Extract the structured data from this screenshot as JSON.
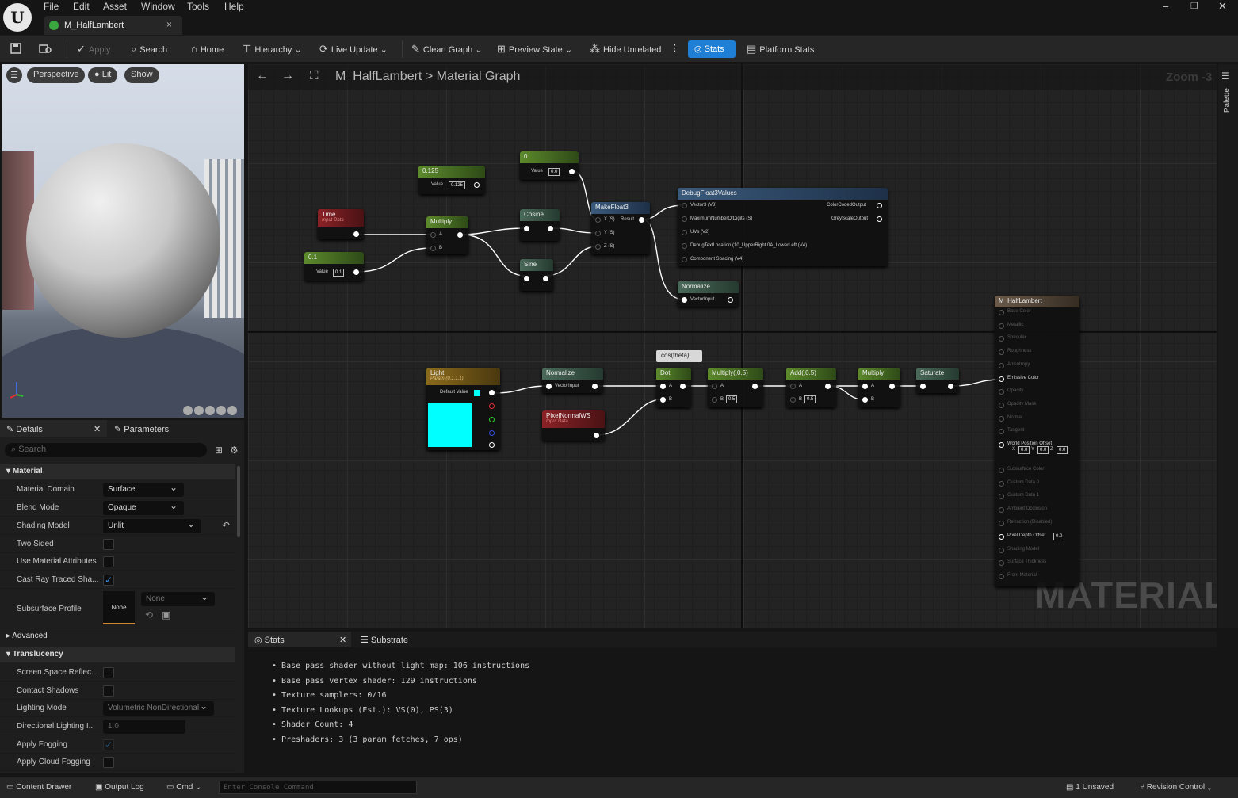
{
  "menubar": {
    "logo": "U",
    "items": [
      "File",
      "Edit",
      "Asset",
      "Window",
      "Tools",
      "Help"
    ],
    "tab_title": "M_HalfLambert",
    "tab_close": "×",
    "win_min": "–",
    "win_max": "❐",
    "win_close": "✕"
  },
  "toolbar": {
    "apply": "Apply",
    "search": "Search",
    "home": "Home",
    "hierarchy": "Hierarchy",
    "live_update": "Live Update",
    "clean_graph": "Clean Graph",
    "preview_state": "Preview State",
    "hide_unrelated": "Hide Unrelated",
    "stats": "Stats",
    "platform_stats": "Platform Stats"
  },
  "viewport": {
    "perspective": "Perspective",
    "lit": "Lit",
    "show": "Show"
  },
  "details": {
    "tab_details": "Details",
    "tab_parameters": "Parameters",
    "search_placeholder": "Search",
    "cat_material": "Material",
    "material_domain_label": "Material Domain",
    "material_domain": "Surface",
    "blend_mode_label": "Blend Mode",
    "blend_mode": "Opaque",
    "shading_model_label": "Shading Model",
    "shading_model": "Unlit",
    "two_sided_label": "Two Sided",
    "use_material_attributes_label": "Use Material Attributes",
    "cast_ray_label": "Cast Ray Traced Sha...",
    "subsurface_label": "Subsurface Profile",
    "subsurface_thumb": "None",
    "subsurface_value": "None",
    "cat_advanced": "Advanced",
    "cat_translucency": "Translucency",
    "ssr_label": "Screen Space Reflec...",
    "contact_shadows_label": "Contact Shadows",
    "lighting_mode_label": "Lighting Mode",
    "lighting_mode": "Volumetric NonDirectional",
    "directional_label": "Directional Lighting I...",
    "directional_value": "1.0",
    "apply_fogging_label": "Apply Fogging",
    "apply_cloud_label": "Apply Cloud Fogging"
  },
  "graph": {
    "breadcrumb_asset": "M_HalfLambert",
    "breadcrumb_sep": ">",
    "breadcrumb_graph": "Material Graph",
    "zoom": "Zoom -3",
    "watermark": "MATERIAL",
    "palette": "Palette",
    "nodes": {
      "c0125": {
        "title": "0.125",
        "value_label": "Value",
        "value": "0.125"
      },
      "c0": {
        "title": "0",
        "value_label": "Value",
        "value": "0.0"
      },
      "time": {
        "title": "Time",
        "sub": "Input Data"
      },
      "c01": {
        "title": "0.1",
        "value_label": "Value",
        "value": "0.1"
      },
      "multiply1": {
        "title": "Multiply",
        "a": "A",
        "b": "B"
      },
      "cosine": {
        "title": "Cosine"
      },
      "sine": {
        "title": "Sine"
      },
      "makefloat3": {
        "title": "MakeFloat3",
        "x": "X (S)",
        "y": "Y (S)",
        "z": "Z (S)",
        "result": "Result"
      },
      "debug": {
        "title": "DebugFloat3Values",
        "in1": "Vector3 (V3)",
        "in2": "MaximumNumberOfDigits (S)",
        "in3": "UVs (V2)",
        "in4": "DebugTextLocation (10_UpperRight 0A_LowerLeft (V4)",
        "in5": "Component Spacing (V4)",
        "out1": "ColorCodedOutput",
        "out2": "GreyScaleOutput"
      },
      "normalize1": {
        "title": "Normalize",
        "input": "VectorInput"
      },
      "light": {
        "title": "Light",
        "sub": "Param (0,1,1,1)",
        "default": "Default Value"
      },
      "normalize2": {
        "title": "Normalize",
        "input": "VectorInput"
      },
      "pixelnormal": {
        "title": "PixelNormalWS",
        "sub": "Input Data"
      },
      "comment": {
        "title": "cos(theta)"
      },
      "dot": {
        "title": "Dot",
        "a": "A",
        "b": "B"
      },
      "multiply05": {
        "title": "Multiply(,0.5)",
        "a": "A",
        "b": "B",
        "bval": "0.5"
      },
      "add05": {
        "title": "Add(,0.5)",
        "a": "A",
        "b": "B",
        "bval": "0.5"
      },
      "multiply2": {
        "title": "Multiply",
        "a": "A",
        "b": "B"
      },
      "saturate": {
        "title": "Saturate"
      },
      "result": {
        "title": "M_HalfLambert",
        "pins": [
          "Base Color",
          "Metallic",
          "Specular",
          "Roughness",
          "Anisotropy",
          "Emissive Color",
          "Opacity",
          "Opacity Mask",
          "Normal",
          "Tangent",
          "World Position Offset",
          "Subsurface Color",
          "Custom Data 0",
          "Custom Data 1",
          "Ambient Occlusion",
          "Refraction (Disabled)",
          "Pixel Depth Offset",
          "Shading Model",
          "Surface Thickness",
          "Front Material"
        ],
        "wpo_x": "0.0",
        "wpo_y": "0.0",
        "wpo_z": "0.0",
        "pdo": "0.0",
        "x": "X",
        "y": "Y",
        "z": "Z"
      }
    }
  },
  "stats": {
    "tab_stats": "Stats",
    "tab_substrate": "Substrate",
    "lines": [
      "Base pass shader without light map: 106 instructions",
      "Base pass vertex shader: 129 instructions",
      "Texture samplers: 0/16",
      "Texture Lookups (Est.): VS(0), PS(3)",
      "Shader Count: 4",
      "Preshaders: 3  (3 param fetches, 7 ops)"
    ]
  },
  "statusbar": {
    "content_drawer": "Content Drawer",
    "output_log": "Output Log",
    "cmd": "Cmd",
    "cmd_placeholder": "Enter Console Command",
    "unsaved": "1 Unsaved",
    "revision": "Revision Control"
  },
  "colors": {
    "accent": "#1f7fd4",
    "light_swatch": "#00ffff"
  }
}
